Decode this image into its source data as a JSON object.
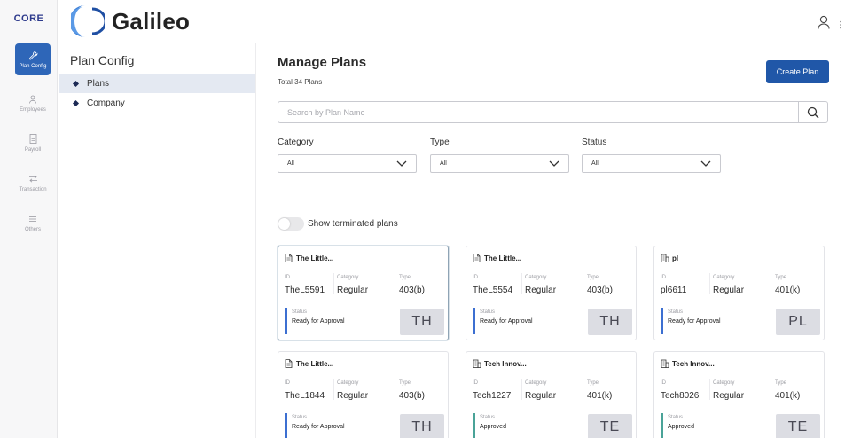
{
  "rail": {
    "logo": "CORE",
    "items": [
      {
        "label": "Plan Config",
        "icon": "wrench-icon",
        "active": true
      },
      {
        "label": "Employees",
        "icon": "person-icon",
        "active": false
      },
      {
        "label": "Payroll",
        "icon": "document-icon",
        "active": false
      },
      {
        "label": "Transaction",
        "icon": "transfer-icon",
        "active": false
      },
      {
        "label": "Others",
        "icon": "grid-icon",
        "active": false
      }
    ]
  },
  "header": {
    "brand": "Galileo"
  },
  "subnav": {
    "title": "Plan Config",
    "items": [
      {
        "label": "Plans",
        "active": true
      },
      {
        "label": "Company",
        "active": false
      }
    ]
  },
  "main": {
    "title": "Manage Plans",
    "subtitle": "Total 34 Plans",
    "create_label": "Create Plan",
    "search_placeholder": "Search by Plan Name",
    "filters": [
      {
        "label": "Category",
        "value": "All"
      },
      {
        "label": "Type",
        "value": "All"
      },
      {
        "label": "Status",
        "value": "All"
      }
    ],
    "toggle_label": "Show terminated plans",
    "column_labels": {
      "id": "ID",
      "category": "Category",
      "type": "Type",
      "status": "Status"
    }
  },
  "cards": [
    {
      "title": "The Little...",
      "id": "TheL5591",
      "category": "Regular",
      "type": "403(b)",
      "status": "Ready for Approval",
      "initials": "TH",
      "icon": "document-icon"
    },
    {
      "title": "The Little...",
      "id": "TheL5554",
      "category": "Regular",
      "type": "403(b)",
      "status": "Ready for Approval",
      "initials": "TH",
      "icon": "document-icon"
    },
    {
      "title": "pl",
      "id": "pl6611",
      "category": "Regular",
      "type": "401(k)",
      "status": "Ready for Approval",
      "initials": "PL",
      "icon": "building-icon"
    },
    {
      "title": "The Little...",
      "id": "TheL1844",
      "category": "Regular",
      "type": "403(b)",
      "status": "Ready for Approval",
      "initials": "TH",
      "icon": "document-icon"
    },
    {
      "title": "Tech Innov...",
      "id": "Tech1227",
      "category": "Regular",
      "type": "401(k)",
      "status": "Approved",
      "initials": "TE",
      "icon": "building-icon"
    },
    {
      "title": "Tech Innov...",
      "id": "Tech8026",
      "category": "Regular",
      "type": "401(k)",
      "status": "Approved",
      "initials": "TE",
      "icon": "building-icon"
    }
  ],
  "colors": {
    "accent": "#2057a8",
    "rail_active": "#2e66b8",
    "status_ready": "#3c6fd1",
    "status_approved": "#4aa398"
  }
}
